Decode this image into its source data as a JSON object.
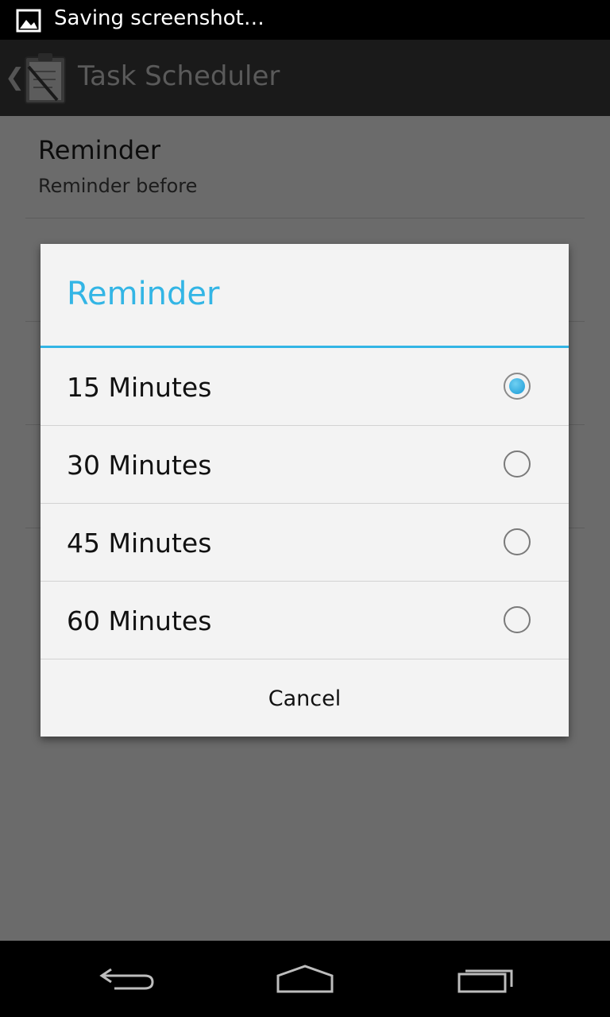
{
  "status_bar": {
    "notification_text": "Saving screenshot…",
    "icon": "image-icon"
  },
  "action_bar": {
    "title": "Task Scheduler",
    "up_icon": "chevron-left-icon",
    "app_icon": "clipboard-icon"
  },
  "background_list": {
    "items": [
      {
        "title": "Reminder",
        "summary": "Reminder before"
      }
    ]
  },
  "dialog": {
    "title": "Reminder",
    "options": [
      {
        "label": "15 Minutes",
        "selected": true
      },
      {
        "label": "30 Minutes",
        "selected": false
      },
      {
        "label": "45 Minutes",
        "selected": false
      },
      {
        "label": "60 Minutes",
        "selected": false
      }
    ],
    "cancel_label": "Cancel"
  },
  "nav_bar": {
    "back_icon": "back-icon",
    "home_icon": "home-icon",
    "recents_icon": "recents-icon"
  },
  "colors": {
    "accent": "#33b5e5",
    "dim_background": "#6b6b6b",
    "dialog_background": "#f3f3f3"
  }
}
